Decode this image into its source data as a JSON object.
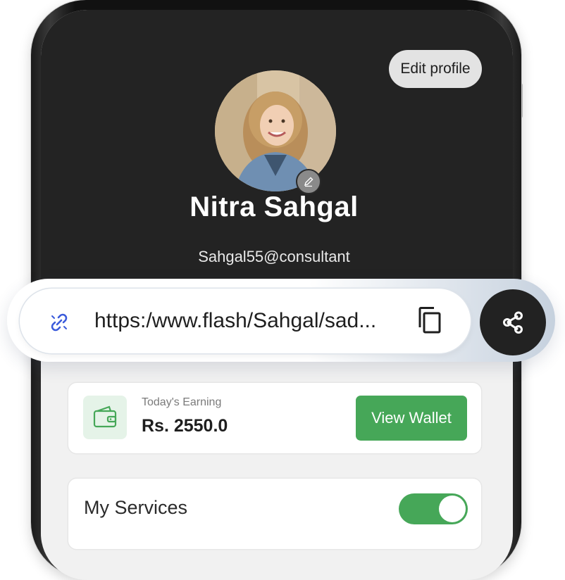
{
  "profile": {
    "edit_label": "Edit profile",
    "name": "Nitra Sahgal",
    "handle": "Sahgal55@consultant"
  },
  "link": {
    "url": "https:/www.flash/Sahgal/sad..."
  },
  "earnings": {
    "label": "Today's Earning",
    "amount": "Rs. 2550.0",
    "button_label": "View Wallet"
  },
  "services": {
    "label": "My Services",
    "toggle_on": true
  },
  "colors": {
    "accent_green": "#46a758",
    "dark_header": "#232323",
    "link_icon_blue": "#3b5bdb"
  },
  "icons": {
    "link": "link-icon",
    "copy": "copy-icon",
    "share": "share-icon",
    "wallet": "wallet-icon",
    "edit": "pencil-icon"
  }
}
